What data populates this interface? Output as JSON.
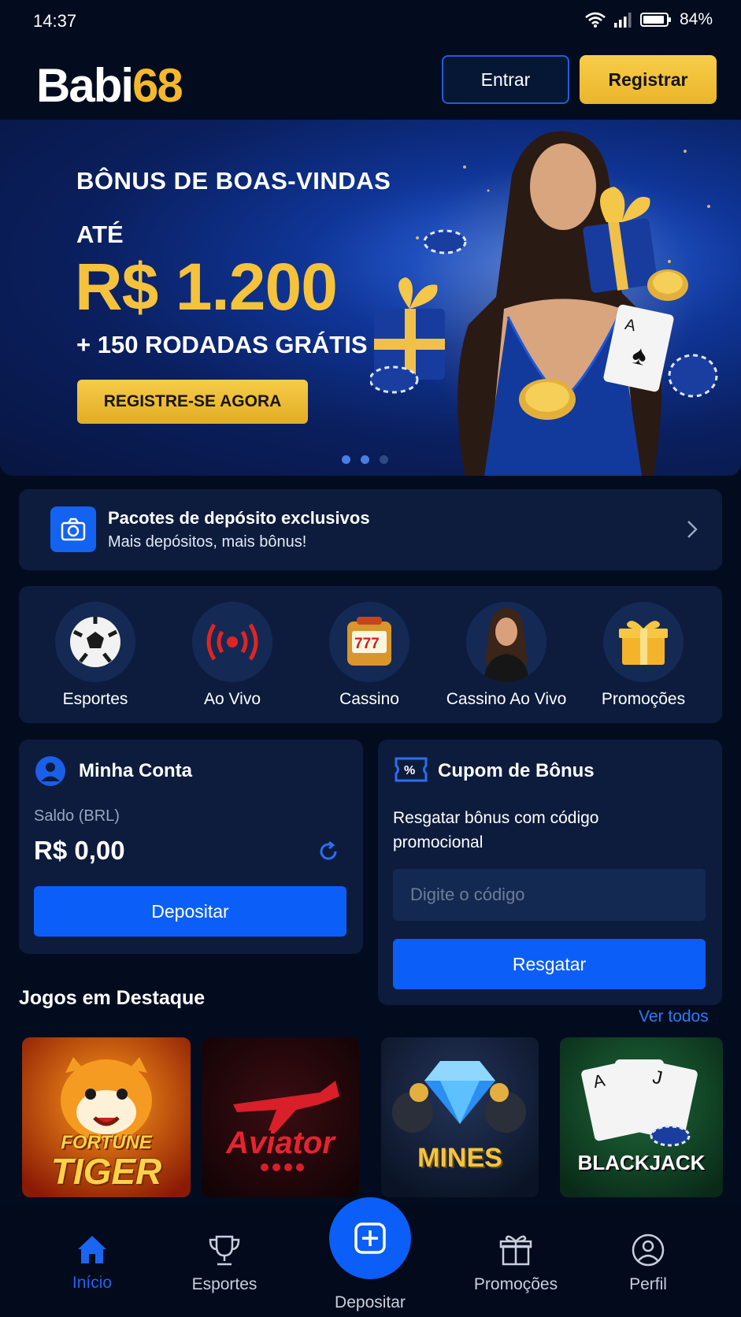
{
  "status": {
    "time": "14:37",
    "battery": "84%"
  },
  "header": {
    "logo_part1": "Babi",
    "logo_part2": "68",
    "login_label": "Entrar",
    "register_label": "Registrar"
  },
  "banner": {
    "subtitle": "BÔNUS DE BOAS-VINDAS",
    "ate": "ATÉ",
    "amount": "R$ 1.200",
    "extra": "+ 150 RODADAS GRÁTIS",
    "cta": "REGISTRE-SE AGORA",
    "slides": 3,
    "active_slide": 1
  },
  "deposit_pack": {
    "title": "Pacotes de depósito exclusivos",
    "subtitle": "Mais depósitos, mais bônus!"
  },
  "categories": [
    {
      "label": "Esportes",
      "icon": "soccer-ball-icon"
    },
    {
      "label": "Ao Vivo",
      "icon": "live-broadcast-icon"
    },
    {
      "label": "Cassino",
      "icon": "slot-machine-icon"
    },
    {
      "label": "Cassino Ao Vivo",
      "icon": "live-dealer-icon"
    },
    {
      "label": "Promoções",
      "icon": "gift-icon"
    }
  ],
  "account": {
    "title": "Minha Conta",
    "balance_label": "Saldo (BRL)",
    "balance": "R$ 0,00",
    "deposit_label": "Depositar"
  },
  "coupon": {
    "title": "Cupom de Bônus",
    "description": "Resgatar bônus com código promocional",
    "placeholder": "Digite o código",
    "redeem_label": "Resgatar"
  },
  "featured": {
    "title": "Jogos em Destaque",
    "see_all": "Ver todos"
  },
  "games": [
    {
      "line1": "FORTUNE",
      "line2": "TIGER"
    },
    {
      "line1": "Aviator"
    },
    {
      "line1": "MINES"
    },
    {
      "line1": "BLACKJACK"
    }
  ],
  "nav": [
    {
      "label": "Início",
      "icon": "home-icon"
    },
    {
      "label": "Esportes",
      "icon": "trophy-icon"
    },
    {
      "label": "Depositar",
      "icon": "plus-icon"
    },
    {
      "label": "Promoções",
      "icon": "gift-icon"
    },
    {
      "label": "Perfil",
      "icon": "user-icon"
    }
  ],
  "colors": {
    "background": "#030c1f",
    "accent_blue": "#0b5ef7",
    "gold": "#f5c23c",
    "card": "#0d1c3d"
  }
}
